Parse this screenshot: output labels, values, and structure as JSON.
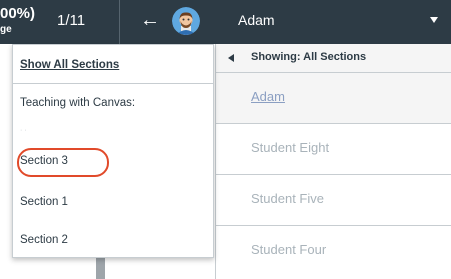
{
  "header": {
    "grade_fragment": "00%)",
    "grade_label_fragment": "ge",
    "student_counter": "1/11",
    "back_arrow": "←",
    "selected_student": "Adam",
    "background_color": "#2d3b45"
  },
  "section_menu": {
    "show_all": "Show All Sections",
    "course_heading": "Teaching with Canvas:",
    "hidden_label": "· ·",
    "items": [
      {
        "label": "Section 3",
        "highlighted": true
      },
      {
        "label": "Section 1",
        "highlighted": false
      },
      {
        "label": "Section 2",
        "highlighted": false
      }
    ],
    "highlight_color": "#e14a2a"
  },
  "student_list": {
    "showing_label": "Showing: All Sections",
    "edge_icon": "⌫",
    "students": [
      {
        "name": "Adam",
        "selected": true
      },
      {
        "name": "Student Eight",
        "selected": false
      },
      {
        "name": "Student Five",
        "selected": false
      },
      {
        "name": "Student Four",
        "selected": false
      }
    ]
  }
}
